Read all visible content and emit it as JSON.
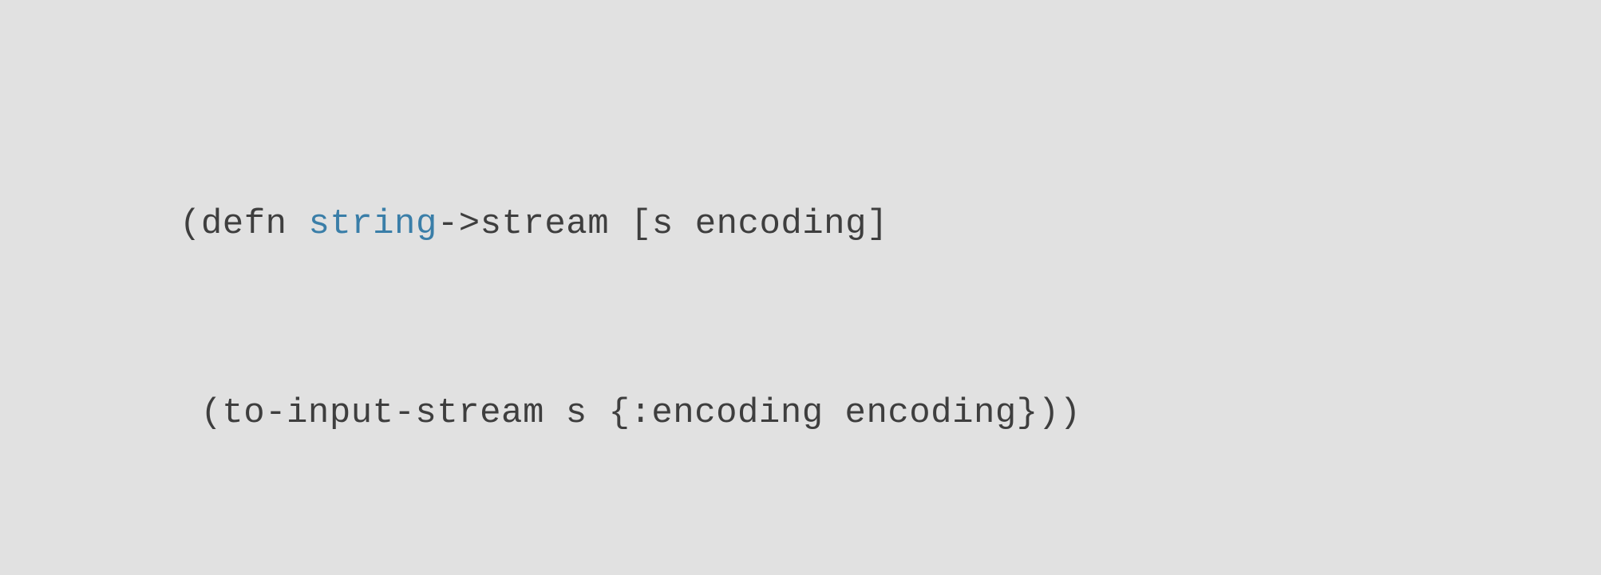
{
  "code": {
    "line1": {
      "open_paren": "(",
      "defn": "defn",
      "space1": " ",
      "fn_name": "string",
      "arrow": "->stream",
      "space2": " ",
      "open_bracket": "[",
      "param1": "s",
      "space3": " ",
      "param2": "encoding",
      "close_bracket": "]"
    },
    "line2": {
      "open_paren": "(",
      "fn_call": "to-input-stream",
      "space1": " ",
      "arg1": "s",
      "space2": " ",
      "open_brace": "{",
      "key": ":encoding",
      "space3": " ",
      "val": "encoding",
      "close_brace": "}",
      "close_paren1": ")",
      "close_paren2": ")"
    }
  }
}
